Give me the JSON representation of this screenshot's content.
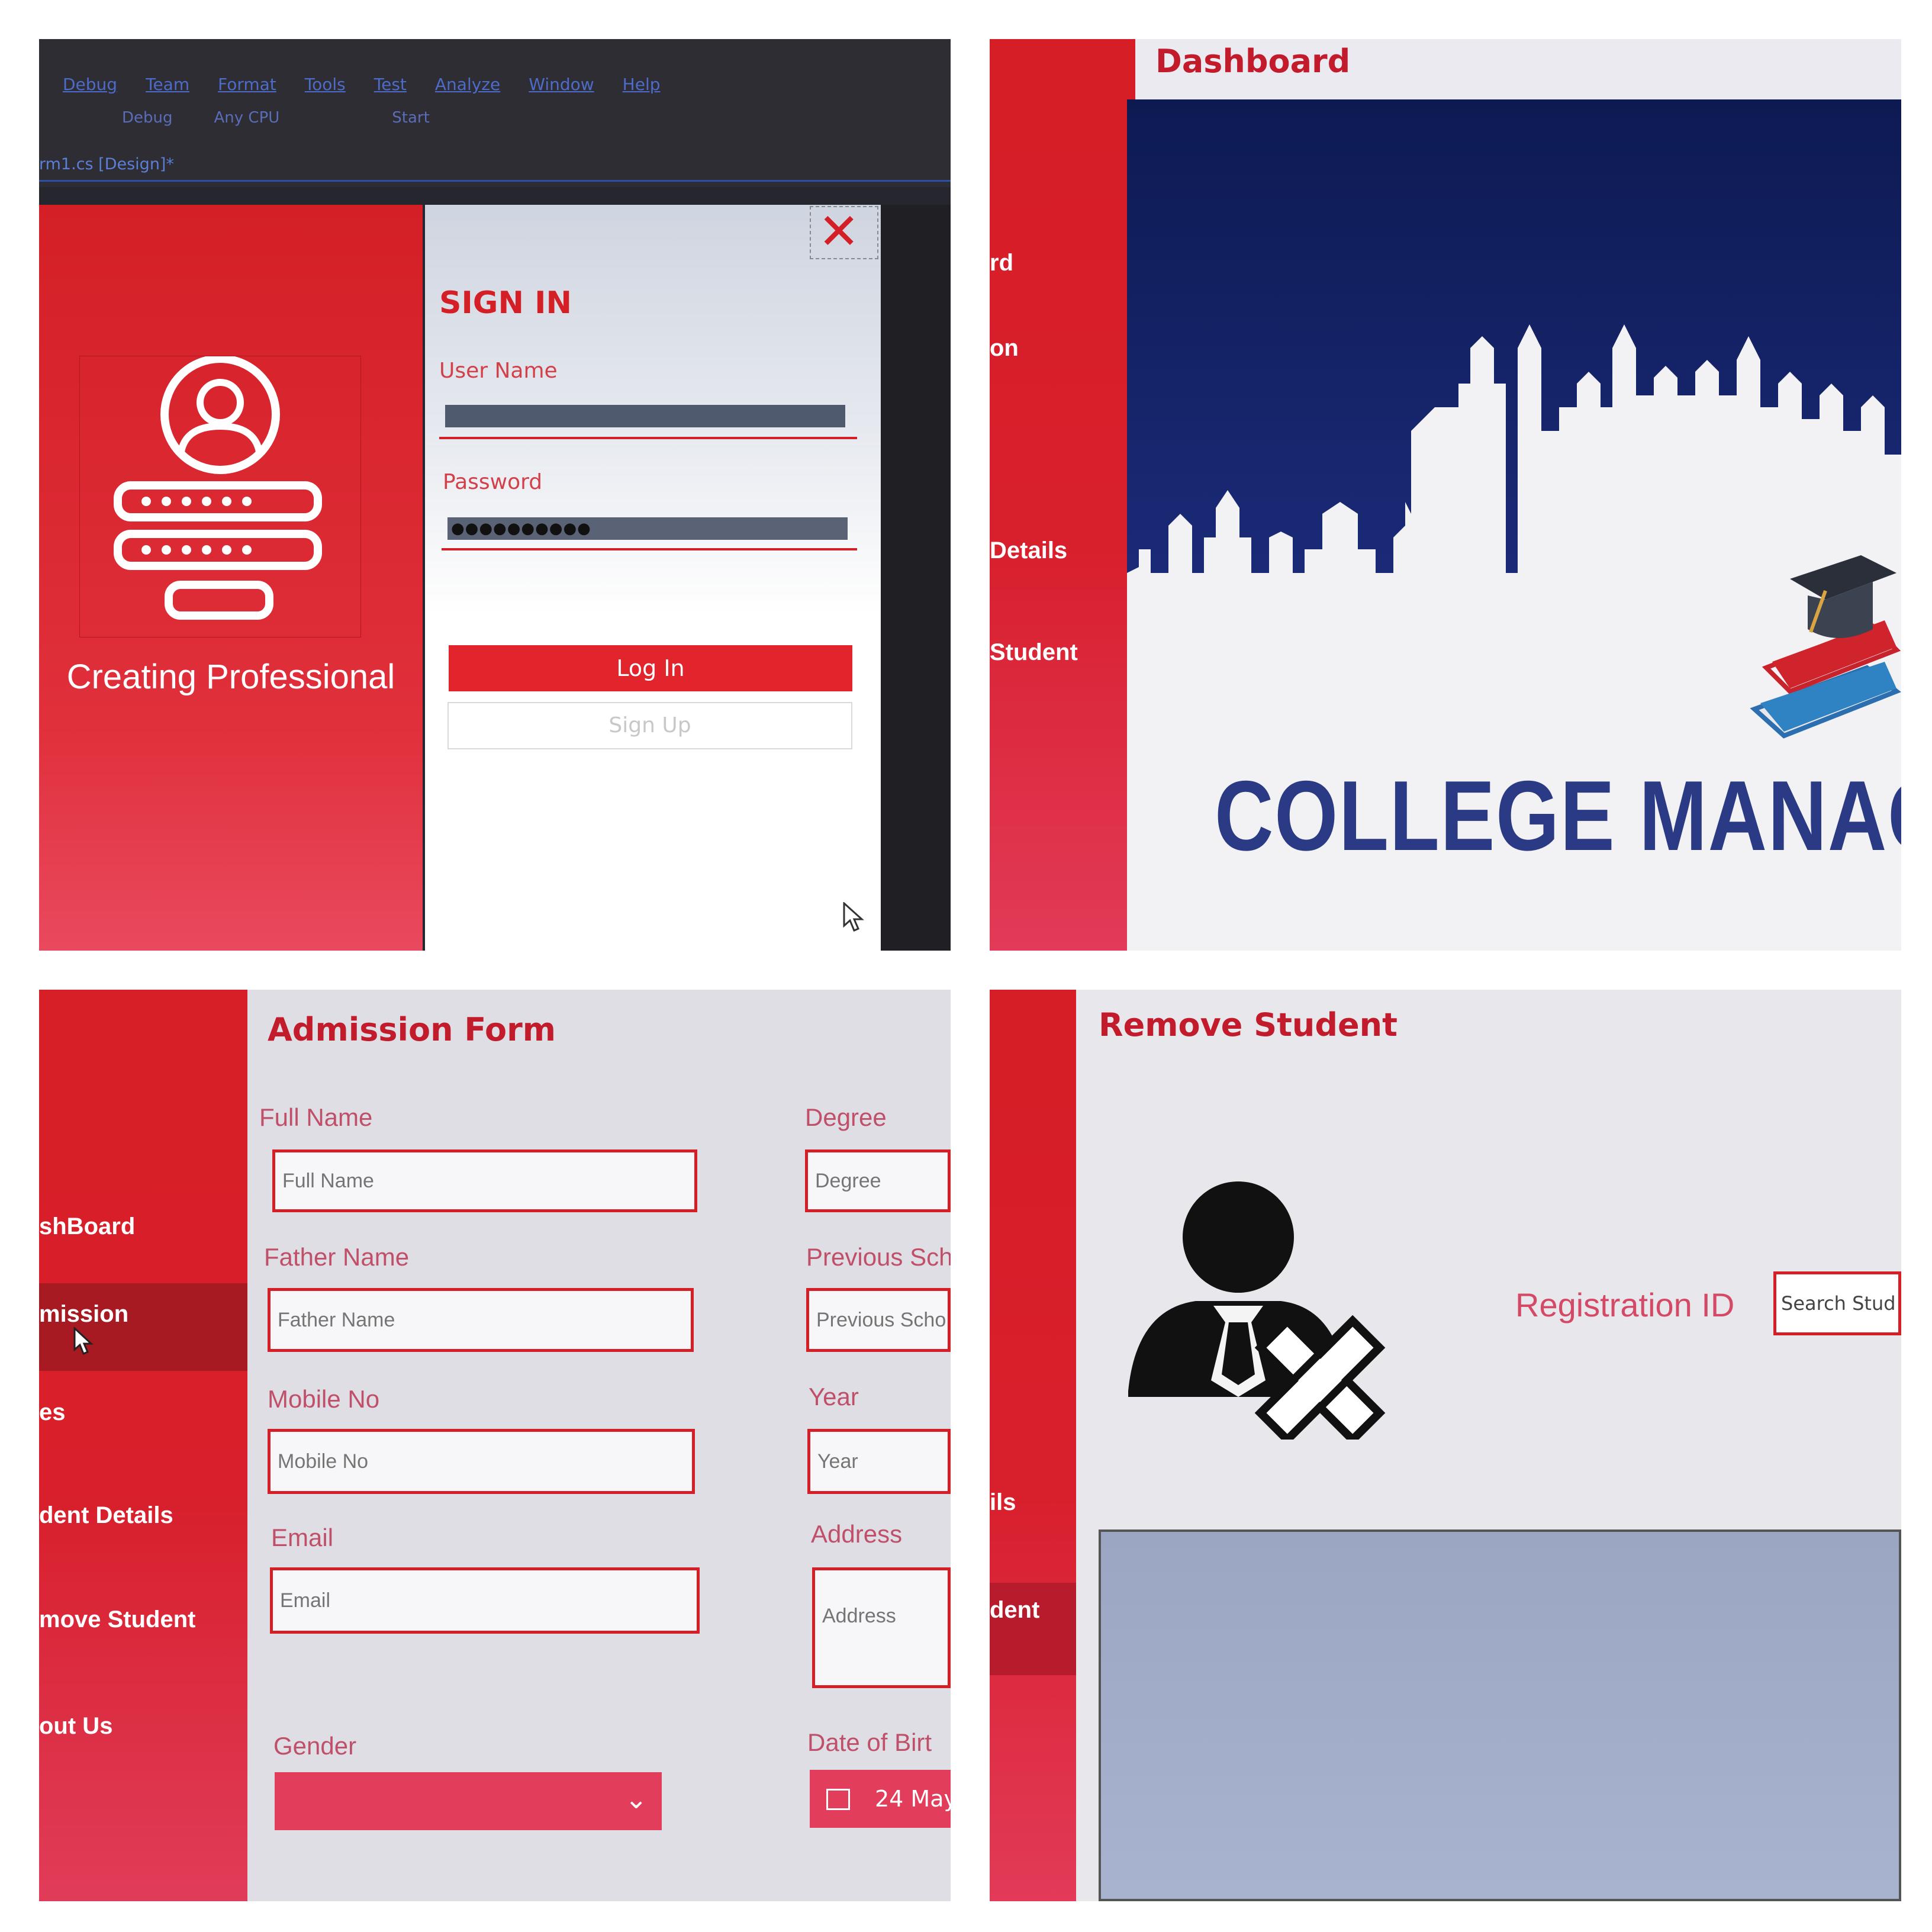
{
  "panel1": {
    "menu": [
      "Debug",
      "Team",
      "Format",
      "Tools",
      "Test",
      "Analyze",
      "Window",
      "Help"
    ],
    "toolbar": [
      "Debug",
      "Any CPU",
      "Start"
    ],
    "tab": "rm1.cs [Design]*",
    "brand_text": "Creating Professional",
    "signin": {
      "title": "SIGN IN",
      "user_label": "User Name",
      "password_label": "Password",
      "password_value": "●●●●●●●●●●",
      "login_label": "Log In",
      "signup_label": "Sign Up"
    }
  },
  "panel2": {
    "title": "Dashboard",
    "sidebar": [
      "rd",
      "on",
      "Details",
      "Student"
    ],
    "banner_text": "COLLEGE MANAGEM"
  },
  "panel3": {
    "title": "Admission Form",
    "sidebar": [
      "shBoard",
      "mission",
      "es",
      "dent Details",
      "move Student",
      "out Us"
    ],
    "left_fields": [
      {
        "label": "Full Name",
        "placeholder": "Full Name"
      },
      {
        "label": "Father Name",
        "placeholder": "Father Name"
      },
      {
        "label": "Mobile No",
        "placeholder": "Mobile No"
      },
      {
        "label": "Email",
        "placeholder": "Email"
      }
    ],
    "right_fields": [
      {
        "label": "Degree",
        "placeholder": "Degree"
      },
      {
        "label": "Previous Sch",
        "placeholder": "Previous Scho"
      },
      {
        "label": "Year",
        "placeholder": "Year"
      },
      {
        "label": "Address",
        "placeholder": "Address"
      }
    ],
    "gender_label": "Gender",
    "dob_label": "Date of Birt",
    "dob_value": "24 May"
  },
  "panel4": {
    "title": "Remove Student",
    "sidebar": [
      "ils",
      "dent"
    ],
    "reg_label": "Registration ID",
    "search_placeholder": "Search Stud"
  },
  "colors": {
    "brand_red": "#d41f26",
    "sidebar_pink": "#e23a58",
    "navy": "#1c2a6e",
    "grid_blue": "#a8b4cf"
  }
}
